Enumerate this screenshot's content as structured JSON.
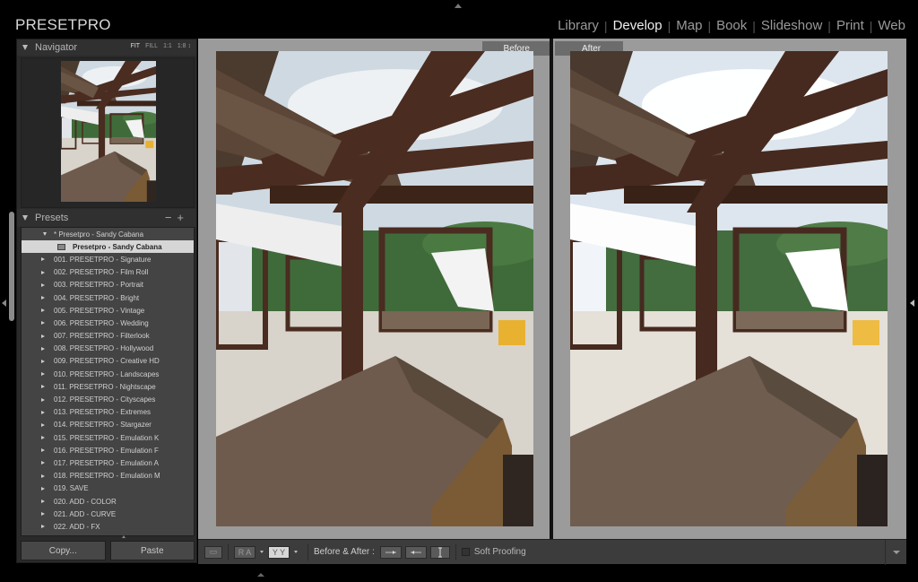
{
  "app": {
    "brand": "PRESETPRO"
  },
  "modules": [
    {
      "label": "Library",
      "active": false
    },
    {
      "label": "Develop",
      "active": true
    },
    {
      "label": "Map",
      "active": false
    },
    {
      "label": "Book",
      "active": false
    },
    {
      "label": "Slideshow",
      "active": false
    },
    {
      "label": "Print",
      "active": false
    },
    {
      "label": "Web",
      "active": false
    }
  ],
  "navigator": {
    "title": "Navigator",
    "zoom_options": [
      "FIT",
      "FILL",
      "1:1",
      "1:8 ↕"
    ],
    "active_zoom": "FIT"
  },
  "presets": {
    "title": "Presets",
    "remove_label": "−",
    "add_label": "+",
    "group": "* Presetpro - Sandy Cabana",
    "selected": "Presetpro - Sandy Cabana",
    "items": [
      "001. PRESETPRO - Signature",
      "002. PRESETPRO - Film Roll",
      "003. PRESETPRO - Portrait",
      "004. PRESETPRO - Bright",
      "005. PRESETPRO - Vintage",
      "006. PRESETPRO - Wedding",
      "007. PRESETPRO - Filterlook",
      "008. PRESETPRO - Hollywood",
      "009. PRESETPRO - Creative HD",
      "010. PRESETPRO - Landscapes",
      "011. PRESETPRO - Nightscape",
      "012. PRESETPRO - Cityscapes",
      "013. PRESETPRO - Extremes",
      "014. PRESETPRO - Stargazer",
      "015. PRESETPRO - Emulation K",
      "016. PRESETPRO - Emulation F",
      "017. PRESETPRO - Emulation A",
      "018. PRESETPRO - Emulation M",
      "019. SAVE",
      "020. ADD - COLOR",
      "021. ADD - CURVE",
      "022. ADD - FX"
    ]
  },
  "buttons": {
    "copy": "Copy...",
    "paste": "Paste"
  },
  "view": {
    "before_label": "Before",
    "after_label": "After"
  },
  "toolbar": {
    "loupe_icon": "▭",
    "ra_label": "R A",
    "yy_label": "Y Y",
    "before_after_label": "Before & After :",
    "soft_proofing_label": "Soft Proofing",
    "soft_proofing_checked": false
  }
}
